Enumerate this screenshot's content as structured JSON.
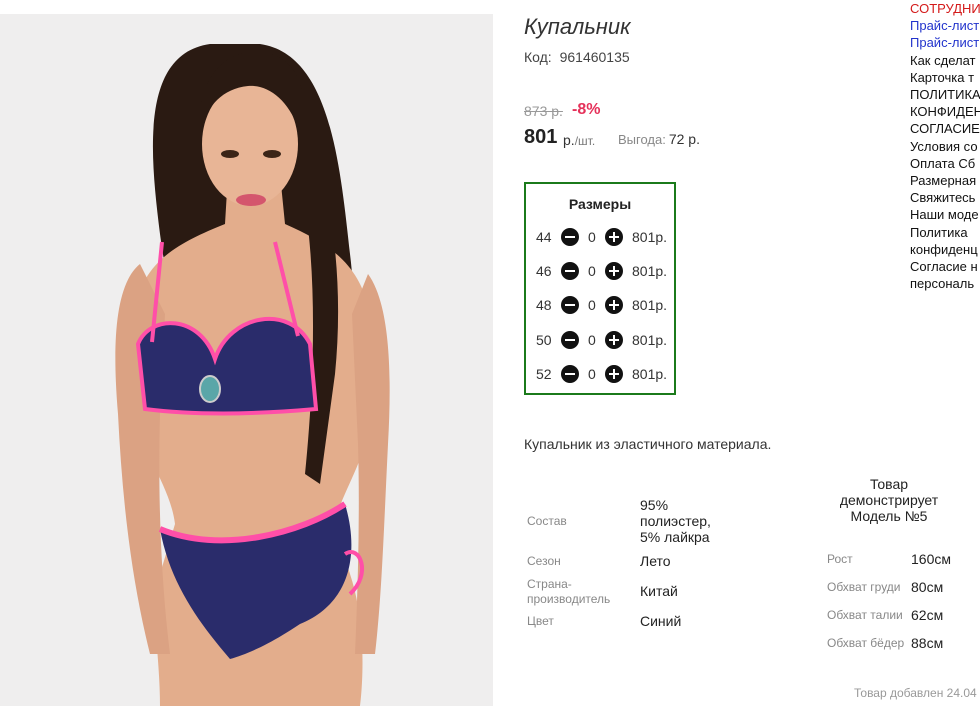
{
  "product": {
    "title": "Купальник",
    "code_label": "Код:",
    "code": "961460135",
    "old_price": "873 р.",
    "discount": "-8%",
    "price": "801",
    "price_unit": "р.",
    "price_per": "/шт.",
    "savings_label": "Выгода:",
    "savings_value": "72 р.",
    "description": "Купальник из эластичного материала.",
    "image_alt": "swimsuit-photo"
  },
  "sizes": {
    "title": "Размеры",
    "rows": [
      {
        "size": "44",
        "qty": "0",
        "price": "801р."
      },
      {
        "size": "46",
        "qty": "0",
        "price": "801р."
      },
      {
        "size": "48",
        "qty": "0",
        "price": "801р."
      },
      {
        "size": "50",
        "qty": "0",
        "price": "801р."
      },
      {
        "size": "52",
        "qty": "0",
        "price": "801р."
      }
    ],
    "border_color": "#1b7a1b"
  },
  "specs": [
    {
      "label": "Состав",
      "value": "95%\nполиэстер,\n5% лайкра"
    },
    {
      "label": "Сезон",
      "value": "Лето"
    },
    {
      "label": "Страна-\nпроизводитель",
      "value": "Китай"
    },
    {
      "label": "Цвет",
      "value": "Синий"
    }
  ],
  "model": {
    "heading": "Товар\nдемонстрирует\nМодель №5",
    "params": [
      {
        "label": "Рост",
        "value": "160см"
      },
      {
        "label": "Обхват груди",
        "value": "80см"
      },
      {
        "label": "Обхват талии",
        "value": "62см"
      },
      {
        "label": "Обхват бёдер",
        "value": "88см"
      }
    ]
  },
  "added_text": "Товар добавлен 24.04",
  "side_links": [
    {
      "text": "СОТРУДНИ",
      "color": "red"
    },
    {
      "text": "Прайс-лист",
      "color": "blue"
    },
    {
      "text": "Прайс-лист",
      "color": "blue"
    },
    {
      "text": "Как сделат",
      "color": "black"
    },
    {
      "text": "Карточка т",
      "color": "black"
    },
    {
      "text": "ПОЛИТИКА",
      "color": "black"
    },
    {
      "text": "КОНФИДЕН",
      "color": "black"
    },
    {
      "text": "СОГЛАСИЕ",
      "color": "black"
    },
    {
      "text": "Условия со",
      "color": "black"
    },
    {
      "text": "Оплата Сб",
      "color": "black"
    },
    {
      "text": "Размерная",
      "color": "black"
    },
    {
      "text": "Свяжитесь",
      "color": "black"
    },
    {
      "text": "Наши моде",
      "color": "black"
    },
    {
      "text": "Политика",
      "color": "black"
    },
    {
      "text": "конфиденц",
      "color": "black"
    },
    {
      "text": "Согласие н",
      "color": "black"
    },
    {
      "text": "персональ",
      "color": "black"
    }
  ],
  "colors": {
    "discount": "#e5315a",
    "link_red": "#d41a1a",
    "link_blue": "#2233cc",
    "swimsuit": "#2a2c6b",
    "trim": "#ff4fa8"
  }
}
